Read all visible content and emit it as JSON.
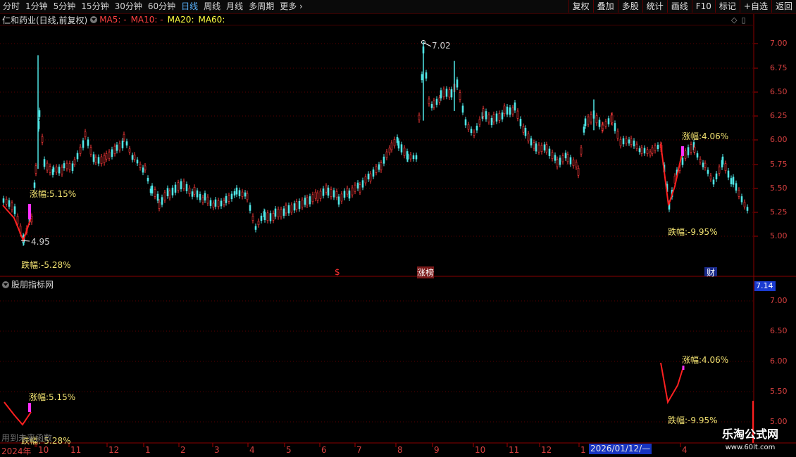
{
  "toolbar": {
    "periods": [
      "分时",
      "1分钟",
      "5分钟",
      "15分钟",
      "30分钟",
      "60分钟",
      "日线",
      "周线",
      "月线",
      "多周期",
      "更多"
    ],
    "active_period": "日线",
    "buttons": [
      "复权",
      "叠加",
      "多股",
      "统计",
      "画线",
      "F10",
      "标记",
      "+自选",
      "返回"
    ]
  },
  "info": {
    "stock": "仁和药业(日线,前复权)",
    "ma5": "MA5: -",
    "ma10": "MA10: -",
    "ma20": "MA20:",
    "ma60": "MA60:"
  },
  "colors": {
    "up": "#ff3a3a",
    "down": "#50e6e6",
    "ma5": "#ff4040",
    "ma20": "#ffff40",
    "annotation": "#f0e070"
  },
  "main_axis": [
    "7.00",
    "6.75",
    "6.50",
    "6.25",
    "6.00",
    "5.75",
    "5.50",
    "5.25",
    "5.00"
  ],
  "sub_axis": [
    "7.00",
    "6.50",
    "6.00",
    "5.50",
    "5.00"
  ],
  "price_box": "7.14",
  "annotations": {
    "high_mark": "7.02",
    "low_mark": "4.95",
    "rise1": "涨幅:5.15%",
    "fall1": "跌幅:-5.28%",
    "rise2": "涨幅:4.06%",
    "fall2": "跌幅:-9.95%"
  },
  "events": {
    "s_mark": "$",
    "limit_up": "涨榜",
    "finance": "财"
  },
  "sub_title": "股朋指标网",
  "ghost_text": "用到未来函数",
  "dates": {
    "year": "2024年",
    "labels": [
      "10",
      "11",
      "12",
      "1",
      "2",
      "3",
      "4",
      "5",
      "6",
      "7",
      "8",
      "9",
      "10",
      "11",
      "12",
      "1",
      "4"
    ],
    "cursor_date": "2026/01/12/—"
  },
  "watermark": {
    "title": "乐淘公式网",
    "url": "www.60lt.com"
  }
}
